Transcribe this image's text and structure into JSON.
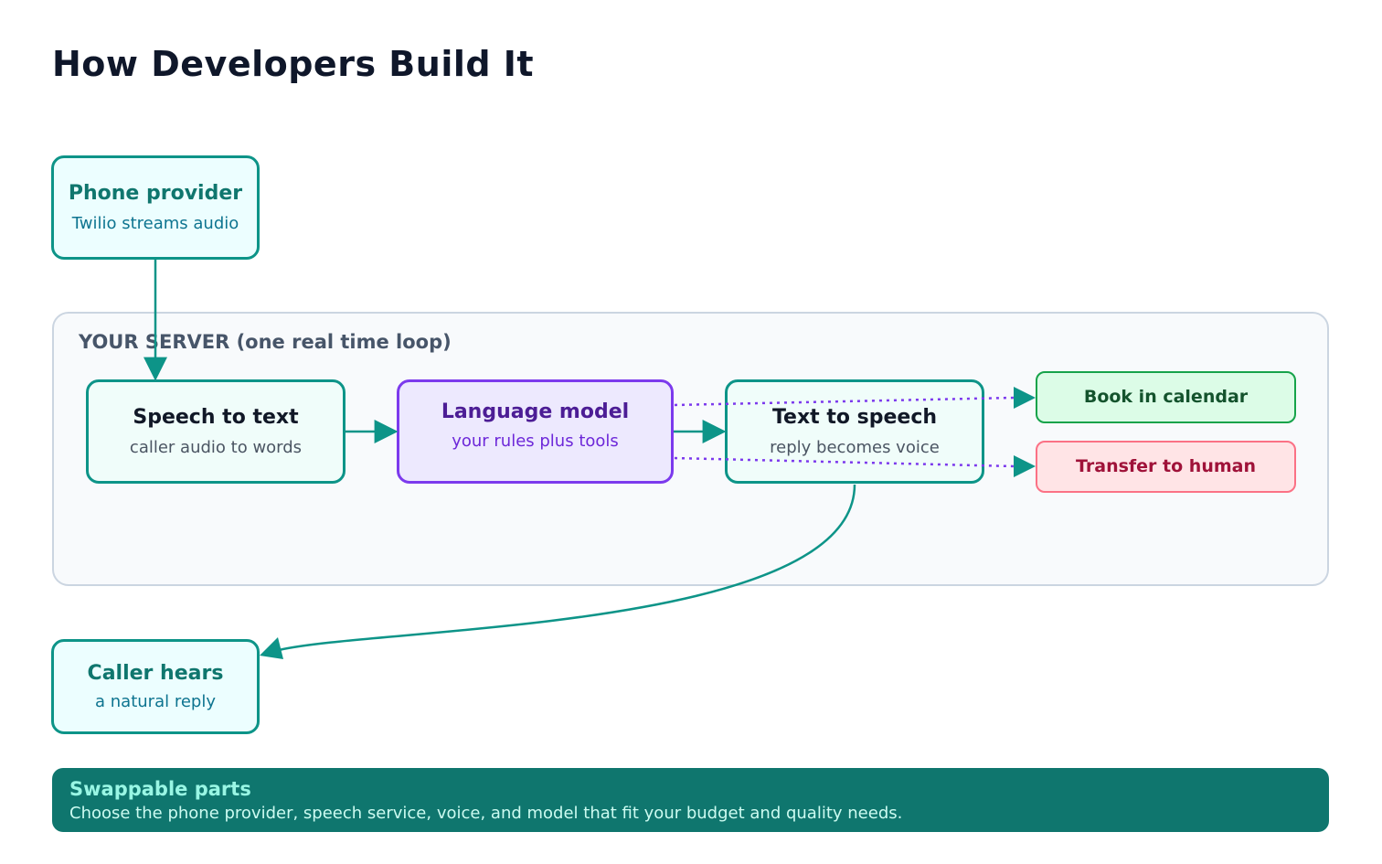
{
  "page": {
    "title": "How Developers Build It"
  },
  "server": {
    "label": "YOUR SERVER (one real time loop)"
  },
  "nodes": {
    "phone_provider": {
      "title": "Phone provider",
      "subtitle": "Twilio streams audio"
    },
    "speech_to_text": {
      "title": "Speech to text",
      "subtitle": "caller audio to words"
    },
    "language_model": {
      "title": "Language model",
      "subtitle": "your rules plus tools"
    },
    "text_to_speech": {
      "title": "Text to speech",
      "subtitle": "reply becomes voice"
    },
    "book_calendar": {
      "title": "Book in calendar"
    },
    "transfer_human": {
      "title": "Transfer to human"
    },
    "caller_hears": {
      "title": "Caller hears",
      "subtitle": "a natural reply"
    }
  },
  "footer": {
    "title": "Swappable parts",
    "text": "Choose the phone provider, speech service, voice, and model that fit your budget and quality needs."
  },
  "colors": {
    "teal": "#0d9488",
    "purple": "#7c3aed",
    "footer_bg": "#0f766e",
    "green": "#16a34a",
    "red": "#fb7185"
  }
}
